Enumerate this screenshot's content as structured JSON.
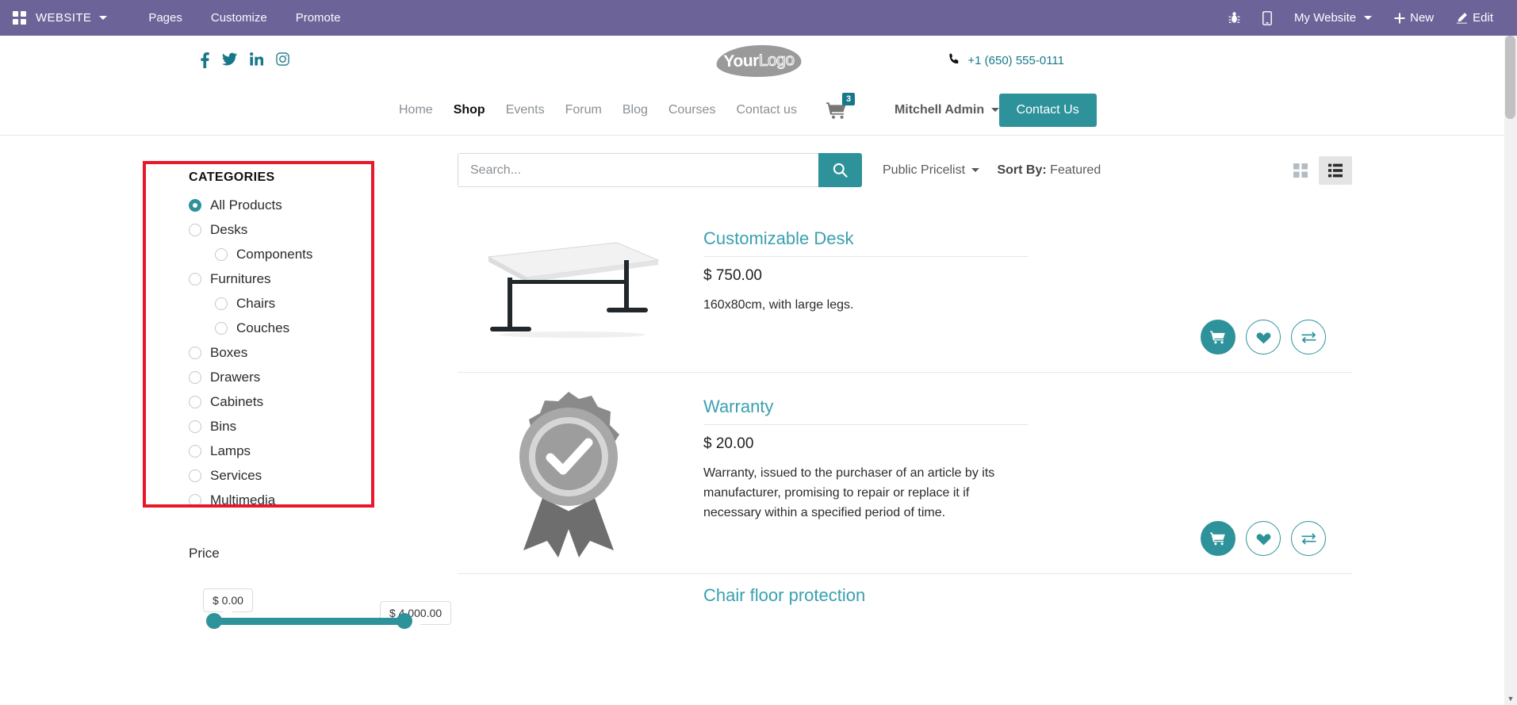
{
  "editor_bar": {
    "brand": "WEBSITE",
    "menu": [
      {
        "label": "Pages",
        "name": "pages"
      },
      {
        "label": "Customize",
        "name": "customize"
      },
      {
        "label": "Promote",
        "name": "promote"
      }
    ],
    "icons": {
      "debug": "bug-icon",
      "mobile": "mobile-preview-icon"
    },
    "website_selector": "My Website",
    "new_label": "New",
    "edit_label": "Edit"
  },
  "header": {
    "social": [
      {
        "name": "facebook-icon",
        "label": "f"
      },
      {
        "name": "twitter-icon",
        "label": "t"
      },
      {
        "name": "linkedin-icon",
        "label": "in"
      },
      {
        "name": "instagram-icon",
        "label": "ig"
      }
    ],
    "logo": {
      "first": "Your",
      "second": "Logo"
    },
    "phone": "+1 (650) 555-0111",
    "nav": [
      {
        "label": "Home",
        "active": false
      },
      {
        "label": "Shop",
        "active": true
      },
      {
        "label": "Events",
        "active": false
      },
      {
        "label": "Forum",
        "active": false
      },
      {
        "label": "Blog",
        "active": false
      },
      {
        "label": "Courses",
        "active": false
      },
      {
        "label": "Contact us",
        "active": false
      }
    ],
    "cart_count": "3",
    "user": "Mitchell Admin",
    "contact_button": "Contact Us"
  },
  "sidebar": {
    "categories_title": "CATEGORIES",
    "categories": [
      {
        "label": "All Products",
        "selected": true,
        "sub": false
      },
      {
        "label": "Desks",
        "selected": false,
        "sub": false
      },
      {
        "label": "Components",
        "selected": false,
        "sub": true
      },
      {
        "label": "Furnitures",
        "selected": false,
        "sub": false
      },
      {
        "label": "Chairs",
        "selected": false,
        "sub": true
      },
      {
        "label": "Couches",
        "selected": false,
        "sub": true
      },
      {
        "label": "Boxes",
        "selected": false,
        "sub": false
      },
      {
        "label": "Drawers",
        "selected": false,
        "sub": false
      },
      {
        "label": "Cabinets",
        "selected": false,
        "sub": false
      },
      {
        "label": "Bins",
        "selected": false,
        "sub": false
      },
      {
        "label": "Lamps",
        "selected": false,
        "sub": false
      },
      {
        "label": "Services",
        "selected": false,
        "sub": false
      },
      {
        "label": "Multimedia",
        "selected": false,
        "sub": false
      }
    ],
    "price_title": "Price",
    "price_min": "$ 0.00",
    "price_max": "$ 4,000.00"
  },
  "toolbar": {
    "search_placeholder": "Search...",
    "search_value": "",
    "pricelist": "Public Pricelist",
    "sort_label": "Sort By:",
    "sort_value": "Featured",
    "grid_view_active": false,
    "list_view_active": true
  },
  "products": [
    {
      "name": "Customizable Desk",
      "price": "$ 750.00",
      "description": "160x80cm, with large legs.",
      "image": "desk-image"
    },
    {
      "name": "Warranty",
      "price": "$ 20.00",
      "description": "Warranty, issued to the purchaser of an article by its manufacturer, promising to repair or replace it if necessary within a specified period of time.",
      "image": "warranty-badge-image"
    },
    {
      "name": "Chair floor protection",
      "price": "",
      "description": "",
      "image": ""
    }
  ],
  "product_actions": {
    "cart": "shopping-cart-icon",
    "wishlist": "heart-icon",
    "compare": "compare-arrows-icon"
  },
  "colors": {
    "editor_purple": "#6c6499",
    "accent_teal": "#2e929b",
    "link_teal": "#3aa0b0",
    "annotation_red": "#e8182a"
  }
}
